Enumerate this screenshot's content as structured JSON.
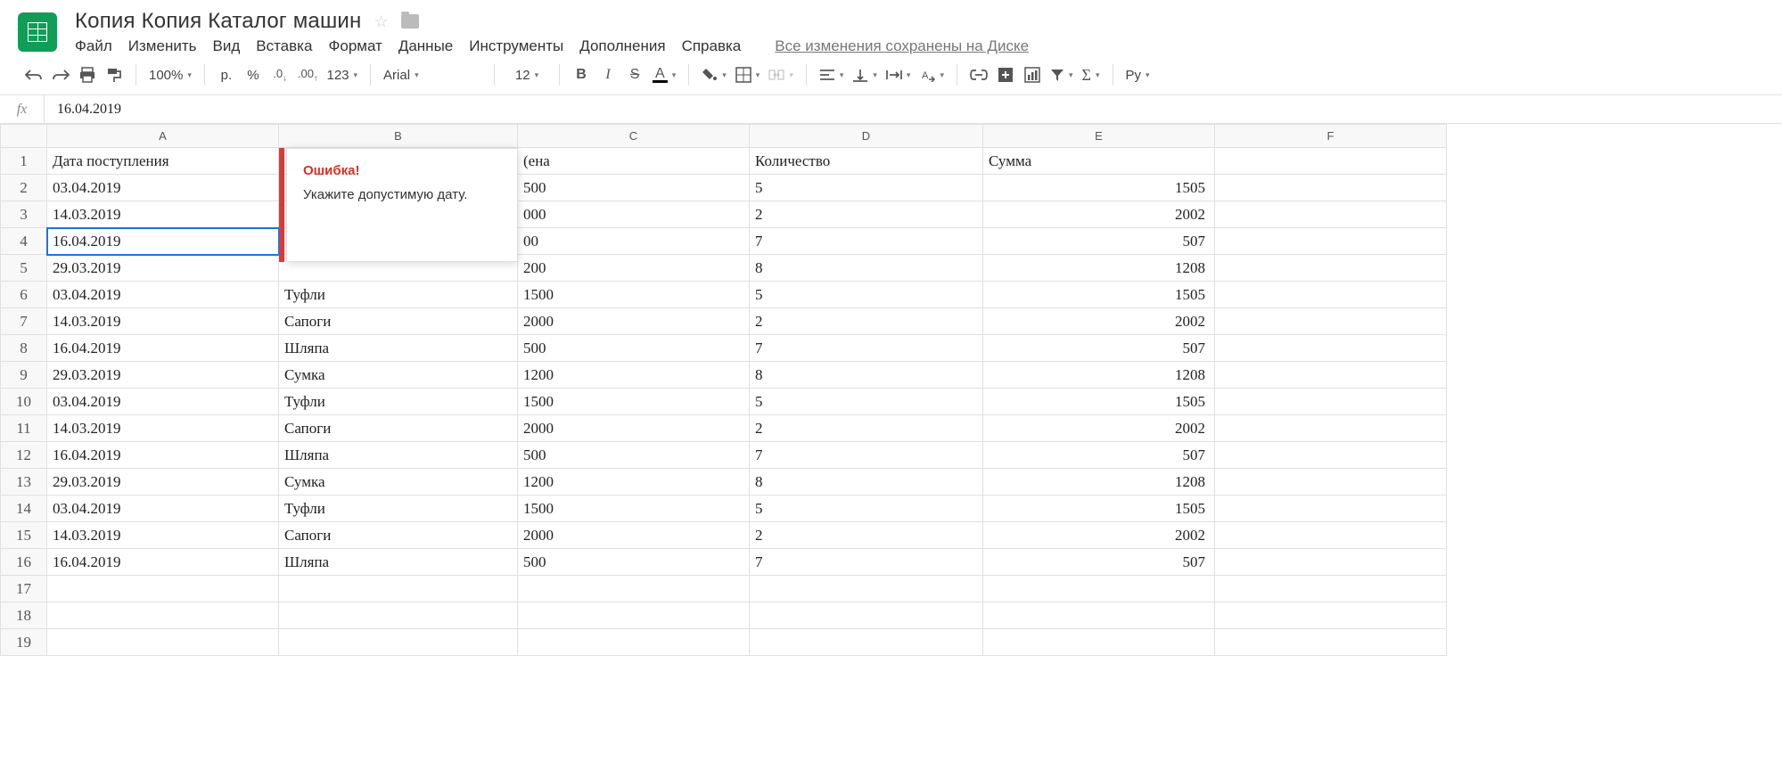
{
  "doc_title": "Копия Копия Каталог машин",
  "menu": {
    "file": "Файл",
    "edit": "Изменить",
    "view": "Вид",
    "insert": "Вставка",
    "format": "Формат",
    "data": "Данные",
    "tools": "Инструменты",
    "addons": "Дополнения",
    "help": "Справка"
  },
  "save_status": "Все изменения сохранены на Диске",
  "toolbar": {
    "zoom": "100%",
    "currency": "р.",
    "percent": "%",
    "dec_dec": ".0",
    "dec_inc": ".00",
    "more_formats": "123",
    "font": "Arial",
    "font_size": "12",
    "bold": "B",
    "italic": "I",
    "strike": "S",
    "text_color": "A",
    "lang": "Ру"
  },
  "formula_bar": {
    "fx": "fx",
    "value": "16.04.2019"
  },
  "columns": [
    "A",
    "B",
    "C",
    "D",
    "E",
    "F"
  ],
  "headers": {
    "A": "Дата поступления",
    "B": "",
    "C": "(ена",
    "D": "Количество",
    "E": "Сумма"
  },
  "rows": [
    {
      "n": 1,
      "A": "Дата поступления",
      "B": "",
      "C": "(ена",
      "D": "Количество",
      "E": "Сумма"
    },
    {
      "n": 2,
      "A": "03.04.2019",
      "B": "",
      "C": "500",
      "D": "5",
      "E": "1505"
    },
    {
      "n": 3,
      "A": "14.03.2019",
      "B": "",
      "C": "000",
      "D": "2",
      "E": "2002"
    },
    {
      "n": 4,
      "A": "16.04.2019",
      "B": "",
      "C": "00",
      "D": "7",
      "E": "507"
    },
    {
      "n": 5,
      "A": "29.03.2019",
      "B": "",
      "C": "200",
      "D": "8",
      "E": "1208"
    },
    {
      "n": 6,
      "A": "03.04.2019",
      "B": "Туфли",
      "C": "1500",
      "D": "5",
      "E": "1505"
    },
    {
      "n": 7,
      "A": "14.03.2019",
      "B": "Сапоги",
      "C": "2000",
      "D": "2",
      "E": "2002"
    },
    {
      "n": 8,
      "A": "16.04.2019",
      "B": "Шляпа",
      "C": "500",
      "D": "7",
      "E": "507"
    },
    {
      "n": 9,
      "A": "29.03.2019",
      "B": "Сумка",
      "C": "1200",
      "D": "8",
      "E": "1208"
    },
    {
      "n": 10,
      "A": "03.04.2019",
      "B": "Туфли",
      "C": "1500",
      "D": "5",
      "E": "1505"
    },
    {
      "n": 11,
      "A": "14.03.2019",
      "B": "Сапоги",
      "C": "2000",
      "D": "2",
      "E": "2002"
    },
    {
      "n": 12,
      "A": "16.04.2019",
      "B": "Шляпа",
      "C": "500",
      "D": "7",
      "E": "507"
    },
    {
      "n": 13,
      "A": "29.03.2019",
      "B": "Сумка",
      "C": "1200",
      "D": "8",
      "E": "1208"
    },
    {
      "n": 14,
      "A": "03.04.2019",
      "B": "Туфли",
      "C": "1500",
      "D": "5",
      "E": "1505"
    },
    {
      "n": 15,
      "A": "14.03.2019",
      "B": "Сапоги",
      "C": "2000",
      "D": "2",
      "E": "2002"
    },
    {
      "n": 16,
      "A": "16.04.2019",
      "B": "Шляпа",
      "C": "500",
      "D": "7",
      "E": "507"
    },
    {
      "n": 17,
      "A": "",
      "B": "",
      "C": "",
      "D": "",
      "E": ""
    },
    {
      "n": 18,
      "A": "",
      "B": "",
      "C": "",
      "D": "",
      "E": ""
    },
    {
      "n": 19,
      "A": "",
      "B": "",
      "C": "",
      "D": "",
      "E": ""
    }
  ],
  "selected_row": 4,
  "tooltip": {
    "title": "Ошибка!",
    "body": "Укажите допустимую дату."
  },
  "col_widths": {
    "rownum": 52,
    "A": 260,
    "B": 268,
    "C": 260,
    "D": 262,
    "E": 260,
    "F": 260
  }
}
